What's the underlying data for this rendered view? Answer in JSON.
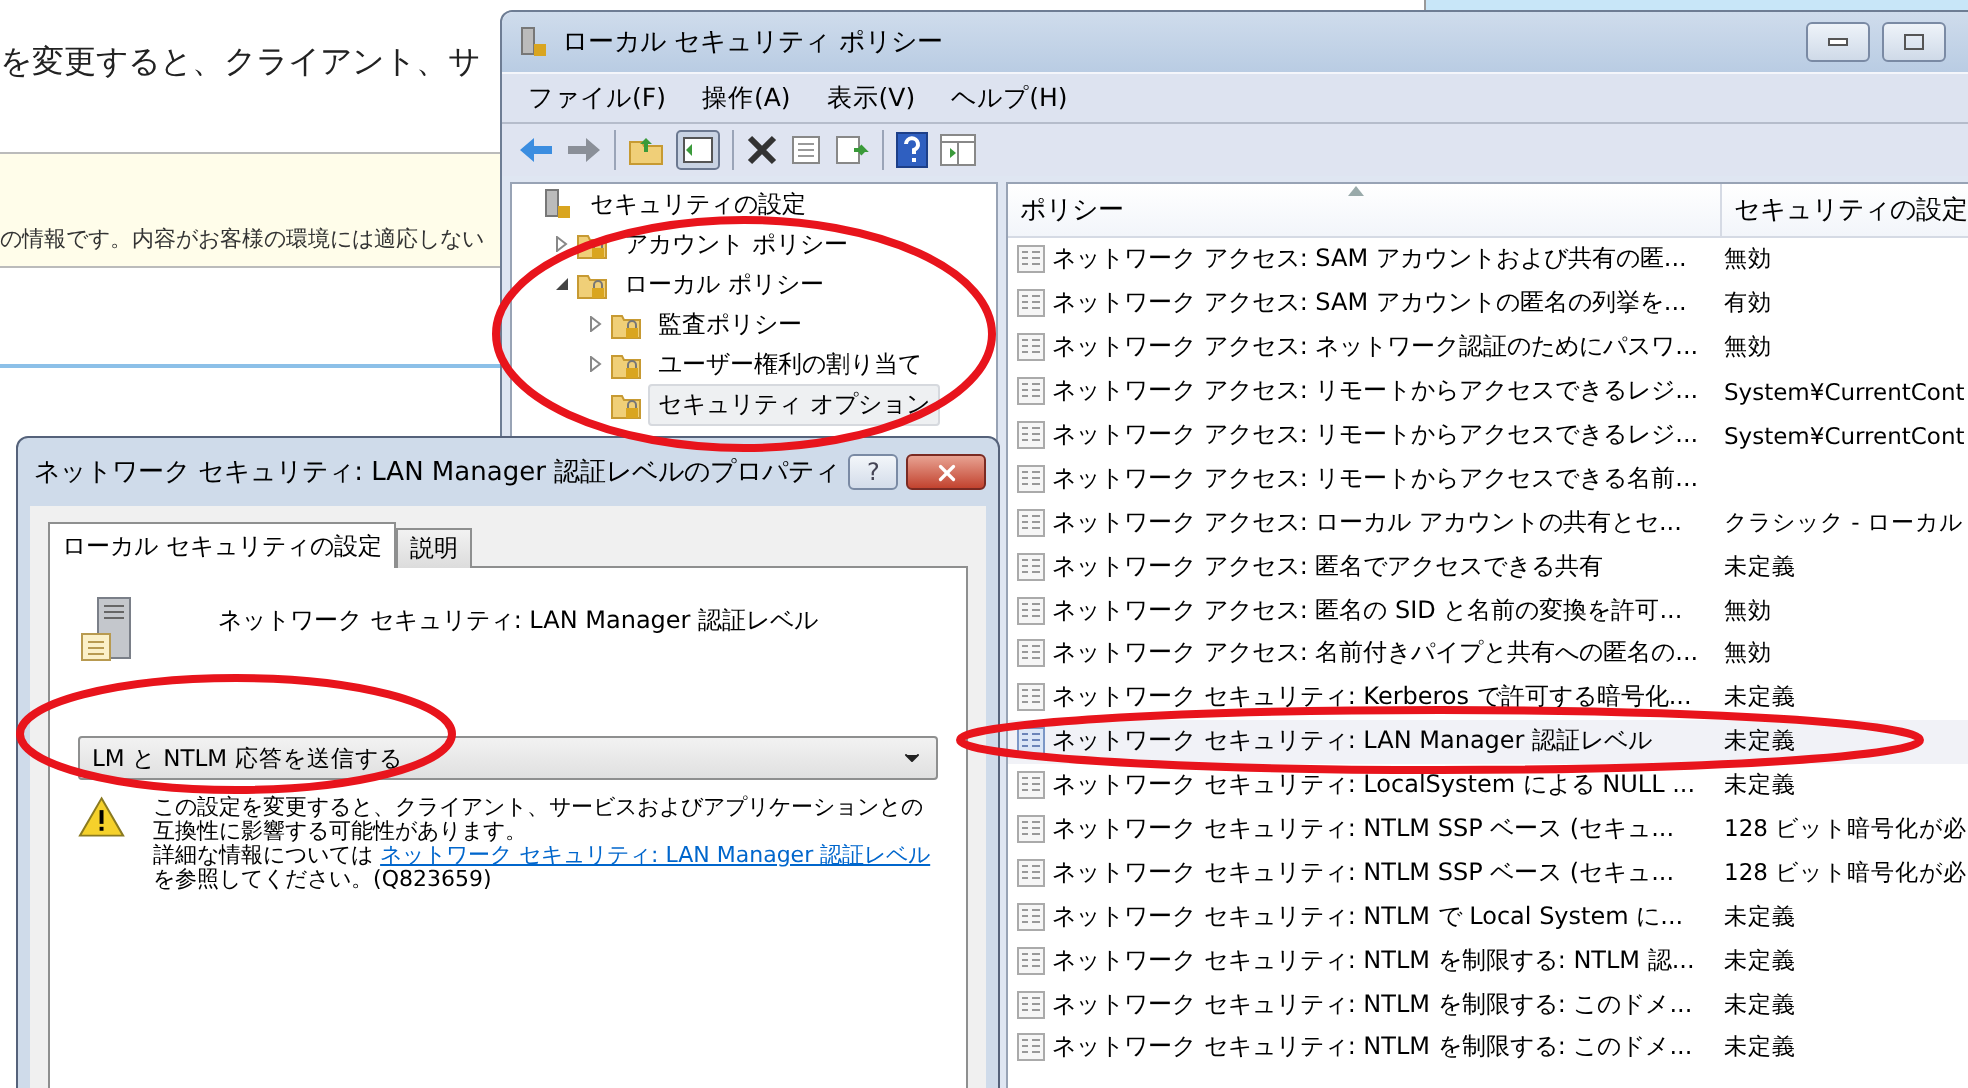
{
  "background_page": {
    "heading": "を変更すると、クライアント、サ",
    "notice": "の情報です。内容がお客様の環境には適応しない"
  },
  "policy_window": {
    "title": "ローカル セキュリティ ポリシー",
    "menu": [
      "ファイル(F)",
      "操作(A)",
      "表示(V)",
      "ヘルプ(H)"
    ],
    "tree": [
      {
        "label": "セキュリティの設定",
        "kind": "root",
        "selected": false,
        "children": [
          {
            "label": "アカウント ポリシー",
            "kind": "folder",
            "expanded": false,
            "selected": false
          },
          {
            "label": "ローカル ポリシー",
            "kind": "folder",
            "expanded": true,
            "selected": false,
            "children": [
              {
                "label": "監査ポリシー",
                "kind": "folder",
                "expanded": false,
                "selected": false
              },
              {
                "label": "ユーザー権利の割り当て",
                "kind": "folder",
                "expanded": false,
                "selected": false
              },
              {
                "label": "セキュリティ オプション",
                "kind": "folder",
                "selected": true
              }
            ]
          }
        ]
      }
    ],
    "columns": [
      "ポリシー",
      "セキュリティの設定"
    ],
    "rows": [
      {
        "policy": "ネットワーク アクセス: SAM アカウントおよび共有の匿...",
        "setting": "無効",
        "selected": false
      },
      {
        "policy": "ネットワーク アクセス: SAM アカウントの匿名の列挙を...",
        "setting": "有効",
        "selected": false
      },
      {
        "policy": "ネットワーク アクセス: ネットワーク認証のためにパスワ...",
        "setting": "無効",
        "selected": false
      },
      {
        "policy": "ネットワーク アクセス: リモートからアクセスできるレジ...",
        "setting": "System¥CurrentCont",
        "selected": false
      },
      {
        "policy": "ネットワーク アクセス: リモートからアクセスできるレジ...",
        "setting": "System¥CurrentCont",
        "selected": false
      },
      {
        "policy": "ネットワーク アクセス: リモートからアクセスできる名前...",
        "selected": false
      },
      {
        "policy": "ネットワーク アクセス: ローカル アカウントの共有とセ...",
        "setting": "クラシック - ローカル",
        "selected": false
      },
      {
        "policy": "ネットワーク アクセス: 匿名でアクセスできる共有",
        "setting": "未定義",
        "selected": false
      },
      {
        "policy": "ネットワーク アクセス: 匿名の SID と名前の変換を許可...",
        "setting": "無効",
        "selected": false
      },
      {
        "policy": "ネットワーク アクセス: 名前付きパイプと共有への匿名の...",
        "setting": "無効",
        "selected": false
      },
      {
        "policy": "ネットワーク セキュリティ: Kerberos で許可する暗号化...",
        "setting": "未定義",
        "selected": false
      },
      {
        "policy": "ネットワーク セキュリティ: LAN Manager 認証レベル",
        "setting": "未定義",
        "selected": true
      },
      {
        "policy": "ネットワーク セキュリティ: LocalSystem による NULL ...",
        "setting": "未定義",
        "selected": false
      },
      {
        "policy": "ネットワーク セキュリティ: NTLM SSP ベース (セキュ...",
        "setting": "128 ビット暗号化が必",
        "selected": false
      },
      {
        "policy": "ネットワーク セキュリティ: NTLM SSP ベース (セキュ...",
        "setting": "128 ビット暗号化が必",
        "selected": false
      },
      {
        "policy": "ネットワーク セキュリティ: NTLM で Local System に...",
        "setting": "未定義",
        "selected": false
      },
      {
        "policy": "ネットワーク セキュリティ: NTLM を制限する: NTLM 認...",
        "setting": "未定義",
        "selected": false
      },
      {
        "policy": "ネットワーク セキュリティ: NTLM を制限する: このドメ...",
        "setting": "未定義",
        "selected": false
      },
      {
        "policy": "ネットワーク セキュリティ: NTLM を制限する: このドメ...",
        "setting": "未定義",
        "selected": false
      }
    ]
  },
  "dialog": {
    "title": "ネットワーク セキュリティ: LAN Manager 認証レベルのプロパティ",
    "help_button": "?",
    "tabs": [
      {
        "label": "ローカル セキュリティの設定",
        "selected": true
      },
      {
        "label": "説明",
        "selected": false
      }
    ],
    "policy_name": "ネットワーク セキュリティ: LAN Manager 認証レベル",
    "dropdown_value": "LM と NTLM 応答を送信する",
    "warning": {
      "text": "この設定を変更すると、クライアント、サービスおよびアプリケーションとの互換性に影響する可能性があります。",
      "details_before": "詳細な情報については ",
      "link": "ネットワーク セキュリティ: LAN Manager 認証レベル",
      "details_after": "を参照してください。(Q823659)"
    }
  }
}
